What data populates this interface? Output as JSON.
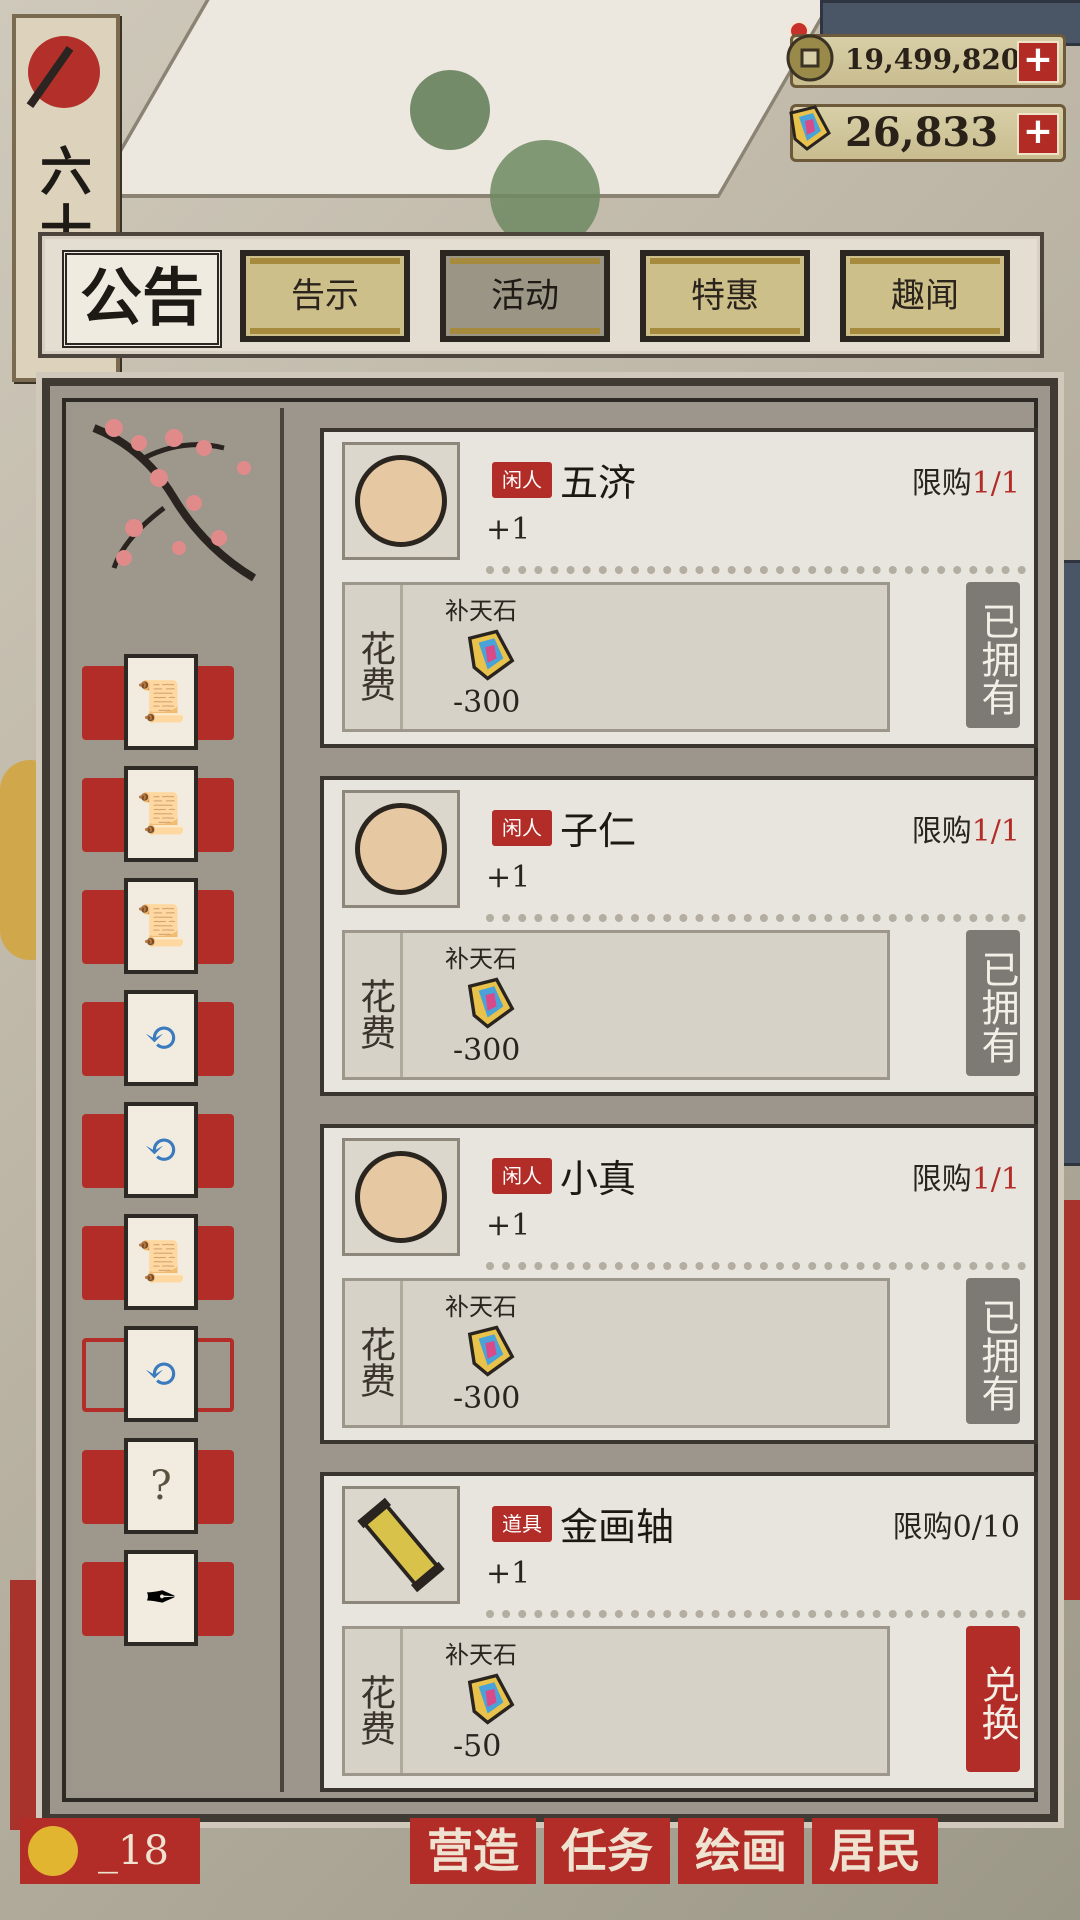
{
  "hud": {
    "side_sign": "六十",
    "coins": "19,499,820",
    "gems": "26,833",
    "plus": "+"
  },
  "header": {
    "title": "公告",
    "tabs": [
      {
        "label": "告示"
      },
      {
        "label": "活动"
      },
      {
        "label": "特惠"
      },
      {
        "label": "趣闻"
      }
    ]
  },
  "categories": [
    {
      "icon": "brush-scroll-icon"
    },
    {
      "icon": "brush-scroll-icon"
    },
    {
      "icon": "brush-scroll-icon"
    },
    {
      "icon": "refresh-arrows-icon"
    },
    {
      "icon": "refresh-arrows-icon"
    },
    {
      "icon": "brush-scroll-icon"
    },
    {
      "icon": "refresh-arrows-icon"
    },
    {
      "icon": "mystery-bag-icon"
    },
    {
      "icon": "scroll-quill-icon"
    }
  ],
  "items": [
    {
      "tag": "闲人",
      "name": "五济",
      "limit_label": "限购",
      "limit_value": "1/1",
      "qty": "+1",
      "cost_label": "花费",
      "cost_name": "补天石",
      "cost_value": "-300",
      "button": "已拥有"
    },
    {
      "tag": "闲人",
      "name": "子仁",
      "limit_label": "限购",
      "limit_value": "1/1",
      "qty": "+1",
      "cost_label": "花费",
      "cost_name": "补天石",
      "cost_value": "-300",
      "button": "已拥有"
    },
    {
      "tag": "闲人",
      "name": "小真",
      "limit_label": "限购",
      "limit_value": "1/1",
      "qty": "+1",
      "cost_label": "花费",
      "cost_name": "补天石",
      "cost_value": "-300",
      "button": "已拥有"
    },
    {
      "tag": "道具",
      "name": "金画轴",
      "limit_label": "限购0/10",
      "limit_value": "",
      "qty": "+1",
      "cost_label": "花费",
      "cost_name": "补天石",
      "cost_value": "-50",
      "button": "兑换"
    }
  ],
  "bottom": {
    "level": "_18",
    "buttons": [
      "营造",
      "任务",
      "绘画",
      "居民"
    ]
  },
  "colors": {
    "accent_red": "#b32d28",
    "owned_gray": "#7d7a75"
  }
}
